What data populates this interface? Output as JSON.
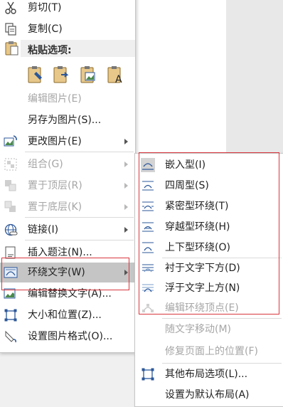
{
  "context_menu": {
    "cut": "剪切(T)",
    "copy": "复制(C)",
    "paste_header": "粘贴选项:",
    "paste_options": [
      {
        "icon": "paste-keep-formatting-icon"
      },
      {
        "icon": "paste-merge-formatting-icon"
      },
      {
        "icon": "paste-picture-icon"
      },
      {
        "icon": "paste-text-only-icon"
      }
    ],
    "edit_picture": "编辑图片(E)",
    "save_as_picture": "另存为图片(S)...",
    "change_picture": "更改图片(E)",
    "group": "组合(G)",
    "bring_to_front": "置于顶层(R)",
    "send_to_back": "置于底层(K)",
    "link": "链接(I)",
    "insert_caption": "插入题注(N)...",
    "wrap_text": "环绕文字(W)",
    "edit_alt_text": "编辑替换文字(A)...",
    "size_position": "大小和位置(Z)...",
    "format_picture": "设置图片格式(O)..."
  },
  "wrap_submenu": {
    "inline": "嵌入型(I)",
    "square": "四周型(S)",
    "tight": "紧密型环绕(T)",
    "through": "穿越型环绕(H)",
    "top_bottom": "上下型环绕(O)",
    "behind_text": "衬于文字下方(D)",
    "in_front": "浮于文字上方(N)",
    "edit_wrap_points": "编辑环绕顶点(E)",
    "move_with_text": "随文字移动(M)",
    "fix_position": "修复页面上的位置(F)",
    "more_layout": "其他布局选项(L)...",
    "set_default": "设置为默认布局(A)"
  },
  "colors": {
    "highlight": "#c5c5c5",
    "annotation_red": "#d8373f",
    "icon_blue": "#2b579a",
    "disabled_text": "#a6a6a6"
  }
}
